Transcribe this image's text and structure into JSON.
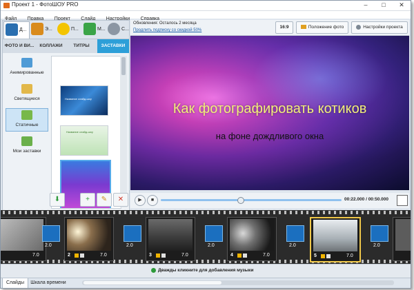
{
  "window": {
    "title": "Проект 1 - ФотоШОУ PRO",
    "controls": {
      "minimize": "–",
      "maximize": "□",
      "close": "✕"
    }
  },
  "menu": [
    "Файл",
    "Правка",
    "Проект",
    "Слайд",
    "Настройки",
    "Справка"
  ],
  "left_panel": {
    "top_tabs": [
      {
        "label": "Д...",
        "icon": "photos-icon",
        "active": true
      },
      {
        "label": "Э...",
        "icon": "effects-icon",
        "active": false
      },
      {
        "label": "П...",
        "icon": "star-icon",
        "active": false
      },
      {
        "label": "М...",
        "icon": "music-icon",
        "active": false
      },
      {
        "label": "С...",
        "icon": "settings-icon",
        "active": false
      }
    ],
    "sub_tabs": [
      "ФОТО И ВИ...",
      "КОЛЛАЖИ",
      "ТИТРЫ",
      "ЗАСТАВКИ"
    ],
    "active_sub_tab": "ЗАСТАВКИ",
    "categories": [
      {
        "label": "Анимированные",
        "active": false
      },
      {
        "label": "Светящиеся",
        "active": false
      },
      {
        "label": "Статичные",
        "active": true
      },
      {
        "label": "Мои заставки",
        "active": false
      }
    ],
    "thumb_captions": [
      "Название слайд-шоу",
      "Название слайд-шоу"
    ]
  },
  "top_bar": {
    "update_text": "Обновления: Осталось 2 месяца",
    "renew_link": "Продлить подписку со скидкой 50%",
    "aspect_button": "16:9",
    "photo_position_button": "Положение фото",
    "project_settings_button": "Настройки проекта"
  },
  "preview": {
    "title": "Как фотографировать котиков",
    "subtitle": "на фоне дождливого окна"
  },
  "transport": {
    "time": "00:22.000 / 00:50.000",
    "progress": 0.44
  },
  "filmstrip": {
    "slides": [
      {
        "num": "",
        "duration": "7.0"
      },
      {
        "num": "2",
        "duration": "7.0"
      },
      {
        "num": "3",
        "duration": "7.0"
      },
      {
        "num": "4",
        "duration": "7.0"
      },
      {
        "num": "5",
        "duration": "7.0"
      }
    ],
    "transitions": [
      "2.0",
      "2.0",
      "2.0",
      "2.0",
      "2.0"
    ]
  },
  "music_hint": "Дважды кликните для добавления музыки",
  "bottom_tabs": [
    "Слайды",
    "Шкала времени"
  ],
  "colors": {
    "accent": "#2d9fd8",
    "preview_title": "#f2ef7a",
    "selected_slide": "#f0c84a"
  }
}
